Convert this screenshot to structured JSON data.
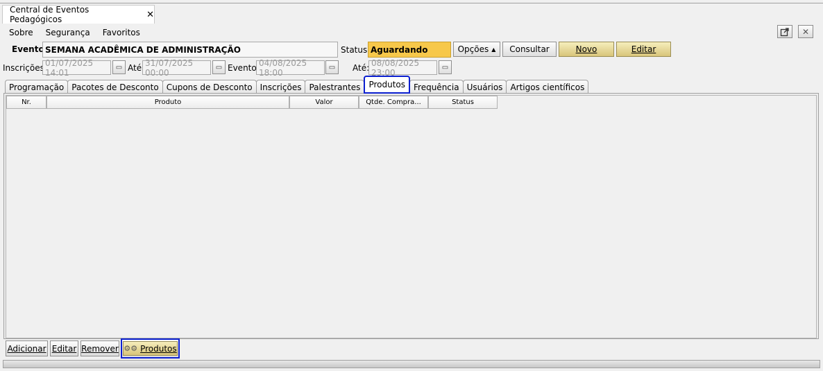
{
  "window": {
    "tab_title": "Central de Eventos Pedagógicos",
    "tab_close": "✕"
  },
  "menu": [
    "Sobre",
    "Segurança",
    "Favoritos"
  ],
  "event": {
    "label": "Evento:",
    "name": "SEMANA ACADÊMICA DE ADMINISTRAÇÃO",
    "status_label": "Status:",
    "status_value": "Aguardando",
    "status_color": "#f7c84a"
  },
  "actions": {
    "options": "Opções",
    "consult": "Consultar",
    "new": "Novo",
    "edit": "Editar"
  },
  "dates": {
    "reg_label": "Inscrições:",
    "reg_start": "01/07/2025 14:01",
    "until_label": "Até:",
    "reg_end": "31/07/2025 00:00",
    "event_label": "Evento:",
    "event_start": "04/08/2025 18:00",
    "until2_label": "Até:",
    "event_end": "08/08/2025 23:00"
  },
  "tabs": [
    "Programação",
    "Pacotes de Desconto",
    "Cupons de Desconto",
    "Inscrições",
    "Palestrantes",
    "Produtos",
    "Frequência",
    "Usuários",
    "Artigos científicos"
  ],
  "active_tab": "Produtos",
  "table": {
    "columns": [
      "Nr.",
      "Produto",
      "Valor",
      "Qtde. Compra...",
      "Status"
    ],
    "rows": []
  },
  "bottom_buttons": {
    "add": "Adicionar",
    "edit": "Editar",
    "remove": "Remover",
    "products": "Produtos"
  },
  "highlight_color": "#0b1fd0"
}
